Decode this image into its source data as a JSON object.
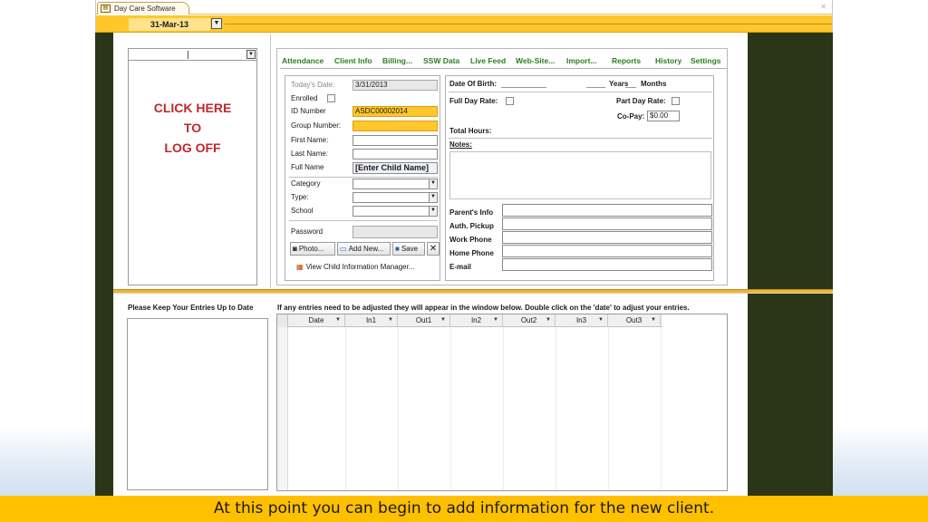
{
  "app": {
    "tab_title": "Day Care Software"
  },
  "date_bar": {
    "date": "31-Mar-13"
  },
  "left_panel": {
    "logoff_line1": "CLICK HERE",
    "logoff_line2": "TO",
    "logoff_line3": "LOG OFF"
  },
  "nav": {
    "attendance": "Attendance",
    "client_info": "Client Info",
    "billing": "Billing...",
    "ssw_data": "SSW Data",
    "live_feed": "Live Feed",
    "website": "Web-Site...",
    "import": "Import...",
    "reports": "Reports",
    "history": "History",
    "settings": "Settings"
  },
  "form": {
    "todays_date_label": "Today's Date:",
    "todays_date_value": "3/31/2013",
    "enrolled_label": "Enrolled",
    "id_number_label": "ID Number",
    "id_number_value": "ASDC00002014",
    "group_number_label": "Group Number:",
    "first_name_label": "First Name:",
    "last_name_label": "Last Name:",
    "full_name_label": "Full Name",
    "full_name_value": "[Enter Child Name]",
    "category_label": "Category",
    "type_label": "Type:",
    "school_label": "School",
    "password_label": "Password",
    "photo_button": "Photo...",
    "add_new_button": "Add New...",
    "save_button": "Save",
    "close_glyph": "✕",
    "view_link": "View Child Information Manager..."
  },
  "details": {
    "dob_label": "Date Of Birth:",
    "years_label": "Years",
    "months_label": "Months",
    "full_day_rate_label": "Full Day Rate:",
    "part_day_rate_label": "Part Day Rate:",
    "copay_label": "Co-Pay:",
    "copay_value": "$0.00",
    "total_hours_label": "Total Hours:",
    "notes_label": "Notes:",
    "parents_info_label": "Parent's Info",
    "auth_pickup_label": "Auth. Pickup",
    "work_phone_label": "Work Phone",
    "home_phone_label": "Home Phone",
    "email_label": "E-mail"
  },
  "lower": {
    "left_title": "Please Keep Your Entries Up to Date",
    "right_title": "If any entries need to be adjusted they will appear in the window below. Double click on the 'date' to adjust your entries.",
    "columns": [
      "Date",
      "In1",
      "Out1",
      "In2",
      "Out2",
      "In3",
      "Out3"
    ]
  },
  "caption": "At this point you can begin to add information for the new client.",
  "colors": {
    "gold": "#ffc72c",
    "nav_green": "#2e7d22",
    "logoff_red": "#c0272d",
    "dark_side": "#2b3618"
  }
}
